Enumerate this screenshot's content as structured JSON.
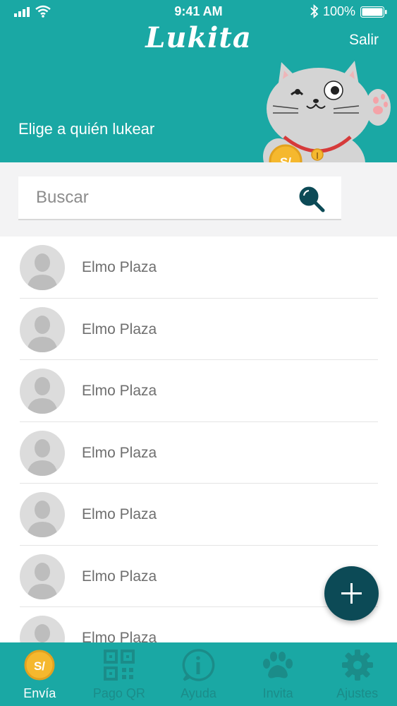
{
  "status_bar": {
    "time": "9:41 AM",
    "battery": "100%"
  },
  "header": {
    "title": "Lukita",
    "logout": "Salir",
    "subtitle": "Elige a quién lukear"
  },
  "coin_symbol": "S/",
  "search": {
    "placeholder": "Buscar",
    "value": ""
  },
  "contacts": [
    {
      "name": "Elmo Plaza"
    },
    {
      "name": "Elmo Plaza"
    },
    {
      "name": "Elmo Plaza"
    },
    {
      "name": "Elmo Plaza"
    },
    {
      "name": "Elmo Plaza"
    },
    {
      "name": "Elmo Plaza"
    },
    {
      "name": "Elmo Plaza"
    }
  ],
  "fab": {
    "icon": "plus-icon"
  },
  "tabs": [
    {
      "label": "Envía",
      "icon": "coin-icon",
      "active": true
    },
    {
      "label": "Pago QR",
      "icon": "qr-code-icon",
      "active": false
    },
    {
      "label": "Ayuda",
      "icon": "info-icon",
      "active": false
    },
    {
      "label": "Invita",
      "icon": "paw-icon",
      "active": false
    },
    {
      "label": "Ajustes",
      "icon": "gear-icon",
      "active": false
    }
  ],
  "colors": {
    "primary": "#1aa8a4",
    "fab": "#0c4a56",
    "tab_inactive": "#1b8c89",
    "coin": "#f5b82e"
  }
}
